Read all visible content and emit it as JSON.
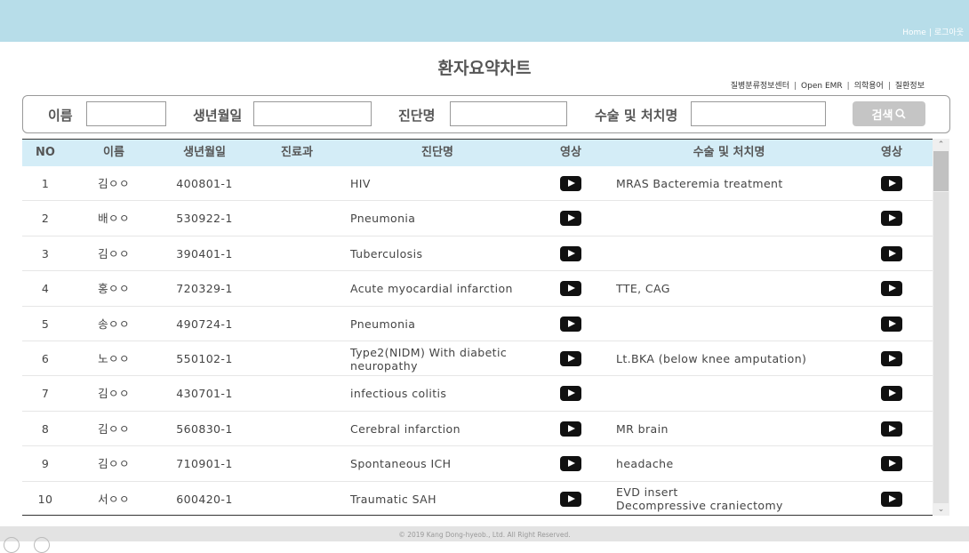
{
  "header": {
    "nav": {
      "home": "Home",
      "separator": "|",
      "logout": "로그아웃"
    }
  },
  "page": {
    "title": "환자요약차트"
  },
  "links": [
    "질병분류정보센터",
    "Open EMR",
    "의학용어",
    "질환정보"
  ],
  "links_separator": "|",
  "search": {
    "name_label": "이름",
    "birth_label": "생년월일",
    "diagnosis_label": "진단명",
    "surgery_label": "수술 및 처치명",
    "name_value": "",
    "birth_value": "",
    "diagnosis_value": "",
    "surgery_value": "",
    "button_label": "검색",
    "button_icon": "search-icon"
  },
  "table": {
    "headers": [
      "NO",
      "이름",
      "생년월일",
      "진료과",
      "진단명",
      "영상",
      "수술 및 처치명",
      "영상"
    ],
    "rows": [
      {
        "no": "1",
        "name": "김ㅇㅇ",
        "birth": "400801-1",
        "dept": "",
        "diagnosis": "HIV",
        "surgery": "MRAS Bacteremia treatment"
      },
      {
        "no": "2",
        "name": "배ㅇㅇ",
        "birth": "530922-1",
        "dept": "",
        "diagnosis": "Pneumonia",
        "surgery": ""
      },
      {
        "no": "3",
        "name": "김ㅇㅇ",
        "birth": "390401-1",
        "dept": "",
        "diagnosis": "Tuberculosis",
        "surgery": ""
      },
      {
        "no": "4",
        "name": "홍ㅇㅇ",
        "birth": "720329-1",
        "dept": "",
        "diagnosis": "Acute myocardial infarction",
        "surgery": "TTE, CAG"
      },
      {
        "no": "5",
        "name": "송ㅇㅇ",
        "birth": "490724-1",
        "dept": "",
        "diagnosis": "Pneumonia",
        "surgery": ""
      },
      {
        "no": "6",
        "name": "노ㅇㅇ",
        "birth": "550102-1",
        "dept": "",
        "diagnosis": "Type2(NIDM) With diabetic neuropathy",
        "surgery": "Lt.BKA (below knee amputation)"
      },
      {
        "no": "7",
        "name": "김ㅇㅇ",
        "birth": "430701-1",
        "dept": "",
        "diagnosis": "infectious colitis",
        "surgery": ""
      },
      {
        "no": "8",
        "name": "김ㅇㅇ",
        "birth": "560830-1",
        "dept": "",
        "diagnosis": "Cerebral infarction",
        "surgery": "MR brain"
      },
      {
        "no": "9",
        "name": "김ㅇㅇ",
        "birth": "710901-1",
        "dept": "",
        "diagnosis": "Spontaneous ICH",
        "surgery": "headache"
      },
      {
        "no": "10",
        "name": "서ㅇㅇ",
        "birth": "600420-1",
        "dept": "",
        "diagnosis": "Traumatic SAH",
        "surgery": "EVD insert\nDecompressive craniectomy"
      }
    ],
    "video_icon": "play-icon"
  },
  "footer": {
    "copyright": "© 2019 Kang Dong-hyeob., Ltd. All Right Reserved."
  },
  "colors": {
    "header_bg": "#b7dde9",
    "table_header_bg": "#d4edf7",
    "search_button_bg": "#c5c5c5"
  }
}
